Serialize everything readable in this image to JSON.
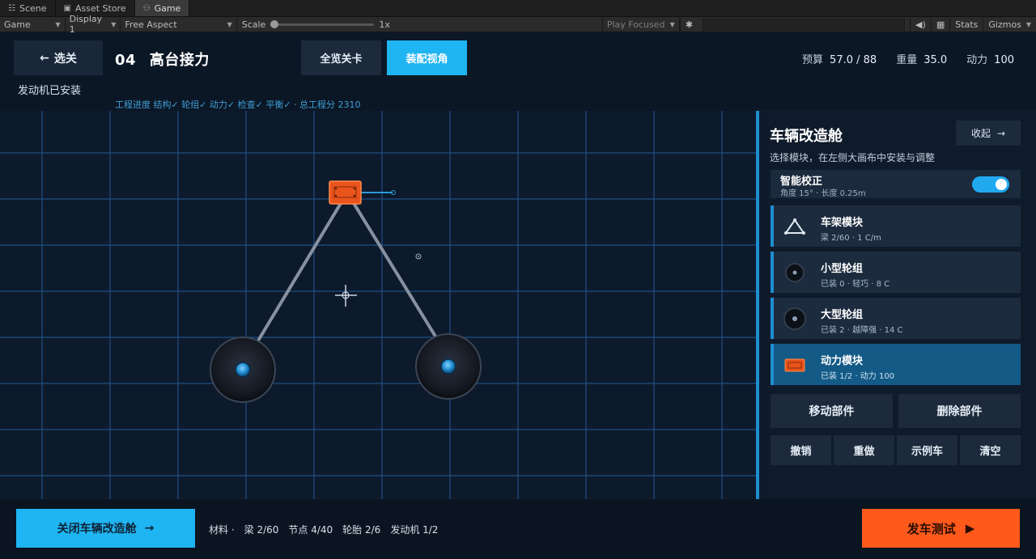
{
  "editor": {
    "tabs": [
      {
        "label": "Scene",
        "icon": "scene-icon"
      },
      {
        "label": "Asset Store",
        "icon": "bag-icon"
      },
      {
        "label": "Game",
        "icon": "gamepad-icon",
        "active": true
      }
    ],
    "toolbar": {
      "view": "Game",
      "display": "Display 1",
      "aspect": "Free Aspect",
      "scale_label": "Scale",
      "scale_value": "1x",
      "play_mode": "Play Focused",
      "stats": "Stats",
      "gizmos": "Gizmos"
    }
  },
  "header": {
    "back_label": "选关",
    "level_number": "04",
    "level_name": "高台接力",
    "engine_status": "发动机已安装",
    "overview_label": "全览关卡",
    "assembly_label": "装配视角",
    "budget_label": "预算",
    "budget_value": "57.0 / 88",
    "weight_label": "重量",
    "weight_value": "35.0",
    "power_label": "动力",
    "power_value": "100",
    "progress": "工程进度  结构✓  轮组✓  动力✓  检查✓  平衡✓  ·  总工程分 2310"
  },
  "panel": {
    "title": "车辆改造舱",
    "collapse_label": "收起",
    "subtitle": "选择模块，在左侧大画布中安装与调整",
    "smart": {
      "title": "智能校正",
      "detail": "角度 15° · 长度 0.25m",
      "enabled": true
    },
    "modules": [
      {
        "name": "车架模块",
        "detail": "梁 2/60 · 1 C/m",
        "icon": "frame-triangle-icon",
        "active": false
      },
      {
        "name": "小型轮组",
        "detail": "已装 0 · 轻巧 · 8 C",
        "icon": "small-wheel-icon",
        "active": false
      },
      {
        "name": "大型轮组",
        "detail": "已装 2 · 越障强 · 14 C",
        "icon": "large-wheel-icon",
        "active": false
      },
      {
        "name": "动力模块",
        "detail": "已装 1/2 · 动力 100",
        "icon": "engine-icon",
        "active": true
      }
    ],
    "actions": {
      "move": "移动部件",
      "delete": "删除部件",
      "undo": "撤销",
      "redo": "重做",
      "sample": "示例车",
      "clear": "清空"
    }
  },
  "footer": {
    "close_label": "关闭车辆改造舱",
    "materials_label": "材料 ·",
    "beams": "梁 2/60",
    "nodes": "节点 4/40",
    "tires": "轮胎 2/6",
    "engines": "发动机 1/2",
    "launch_label": "发车测试"
  },
  "colors": {
    "accent_blue": "#1fb4f2",
    "launch_orange": "#ff5a1c",
    "engine_orange": "#e8541b",
    "grid_blue": "#1e5f9c"
  }
}
